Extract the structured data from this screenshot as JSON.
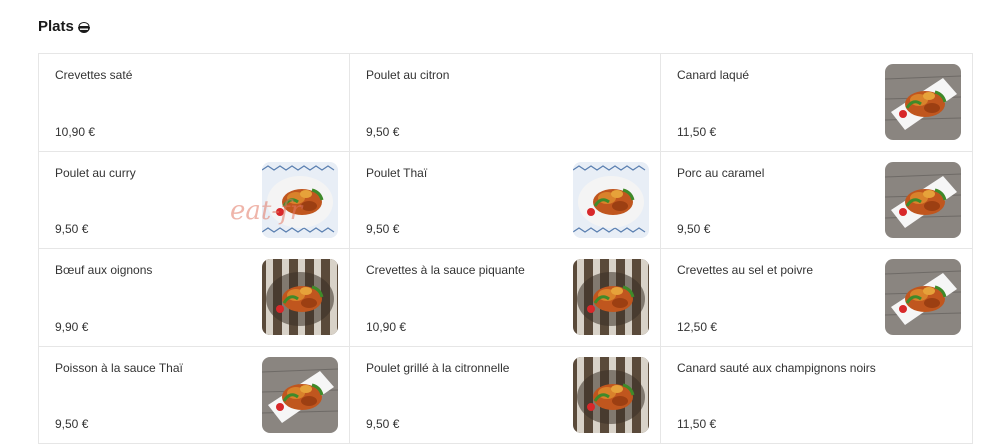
{
  "section": {
    "title": "Plats",
    "icon": "bowl-icon"
  },
  "watermark": "eat-fr",
  "dishes": [
    {
      "name": "Crevettes saté",
      "price": "10,90 €",
      "has_photo": false
    },
    {
      "name": "Poulet au citron",
      "price": "9,50 €",
      "has_photo": false
    },
    {
      "name": "Canard laqué",
      "price": "11,50 €",
      "has_photo": true,
      "photo": "plate-white"
    },
    {
      "name": "Poulet au curry",
      "price": "9,50 €",
      "has_photo": true,
      "photo": "bowl-blue"
    },
    {
      "name": "Poulet Thaï",
      "price": "9,50 €",
      "has_photo": true,
      "photo": "bowl-blue"
    },
    {
      "name": "Porc au caramel",
      "price": "9,50 €",
      "has_photo": true,
      "photo": "plate-white"
    },
    {
      "name": "Bœuf aux oignons",
      "price": "9,90 €",
      "has_photo": true,
      "photo": "striped"
    },
    {
      "name": "Crevettes à la sauce piquante",
      "price": "10,90 €",
      "has_photo": true,
      "photo": "striped"
    },
    {
      "name": "Crevettes au sel et poivre",
      "price": "12,50 €",
      "has_photo": true,
      "photo": "plate-white"
    },
    {
      "name": "Poisson à la sauce Thaï",
      "price": "9,50 €",
      "has_photo": true,
      "photo": "plate-white"
    },
    {
      "name": "Poulet grillé à la citronnelle",
      "price": "9,50 €",
      "has_photo": true,
      "photo": "striped"
    },
    {
      "name": "Canard sauté aux champignons noirs",
      "price": "11,50 €",
      "has_photo": false
    }
  ],
  "colors": {
    "border": "#e6e6e6",
    "text": "#333333",
    "wood": "#8a8580",
    "food": "#c0561e",
    "garnish": "#3f8a2a",
    "blue_pattern": "#5a7fb0"
  }
}
